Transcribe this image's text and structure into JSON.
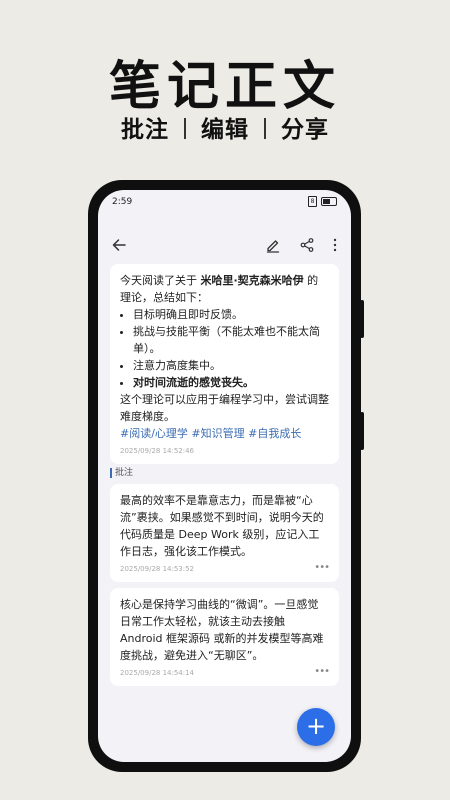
{
  "promo": {
    "title": "笔记正文",
    "sub_1": "批注",
    "sub_2": "编辑",
    "sub_3": "分享"
  },
  "status": {
    "time": "2:59",
    "sim": "8"
  },
  "icons": {
    "back": "arrow-left-icon",
    "edit": "pencil-icon",
    "share": "share-icon",
    "more": "more-vertical-icon",
    "fab": "plus-icon"
  },
  "note": {
    "intro_1": "今天阅读了关于 ",
    "author": "米哈里·契克森米哈伊",
    "intro_2": " 的理论，总结如下：",
    "bullets": [
      "目标明确且即时反馈。",
      "挑战与技能平衡（不能太难也不能太简单）。",
      "注意力高度集中。",
      "对时间流逝的感觉丧失。"
    ],
    "conclusion": "这个理论可以应用于编程学习中，尝试调整难度梯度。",
    "tags": "#阅读/心理学 #知识管理 #自我成长",
    "timestamp": "2025/09/28 14:52:46"
  },
  "annotations_label": "批注",
  "annotations": [
    {
      "text": "最高的效率不是靠意志力，而是靠被“心流”裹挟。如果感觉不到时间，说明今天的代码质量是 Deep Work 级别，应记入工作日志，强化该工作模式。",
      "timestamp": "2025/09/28 14:53:52",
      "more": "•••"
    },
    {
      "text": "核心是保持学习曲线的“微调”。一旦感觉日常工作太轻松，就该主动去接触 Android 框架源码 或新的并发模型等高难度挑战，避免进入“无聊区”。",
      "timestamp": "2025/09/28 14:54:14",
      "more": "•••"
    }
  ],
  "fab_label": "+"
}
